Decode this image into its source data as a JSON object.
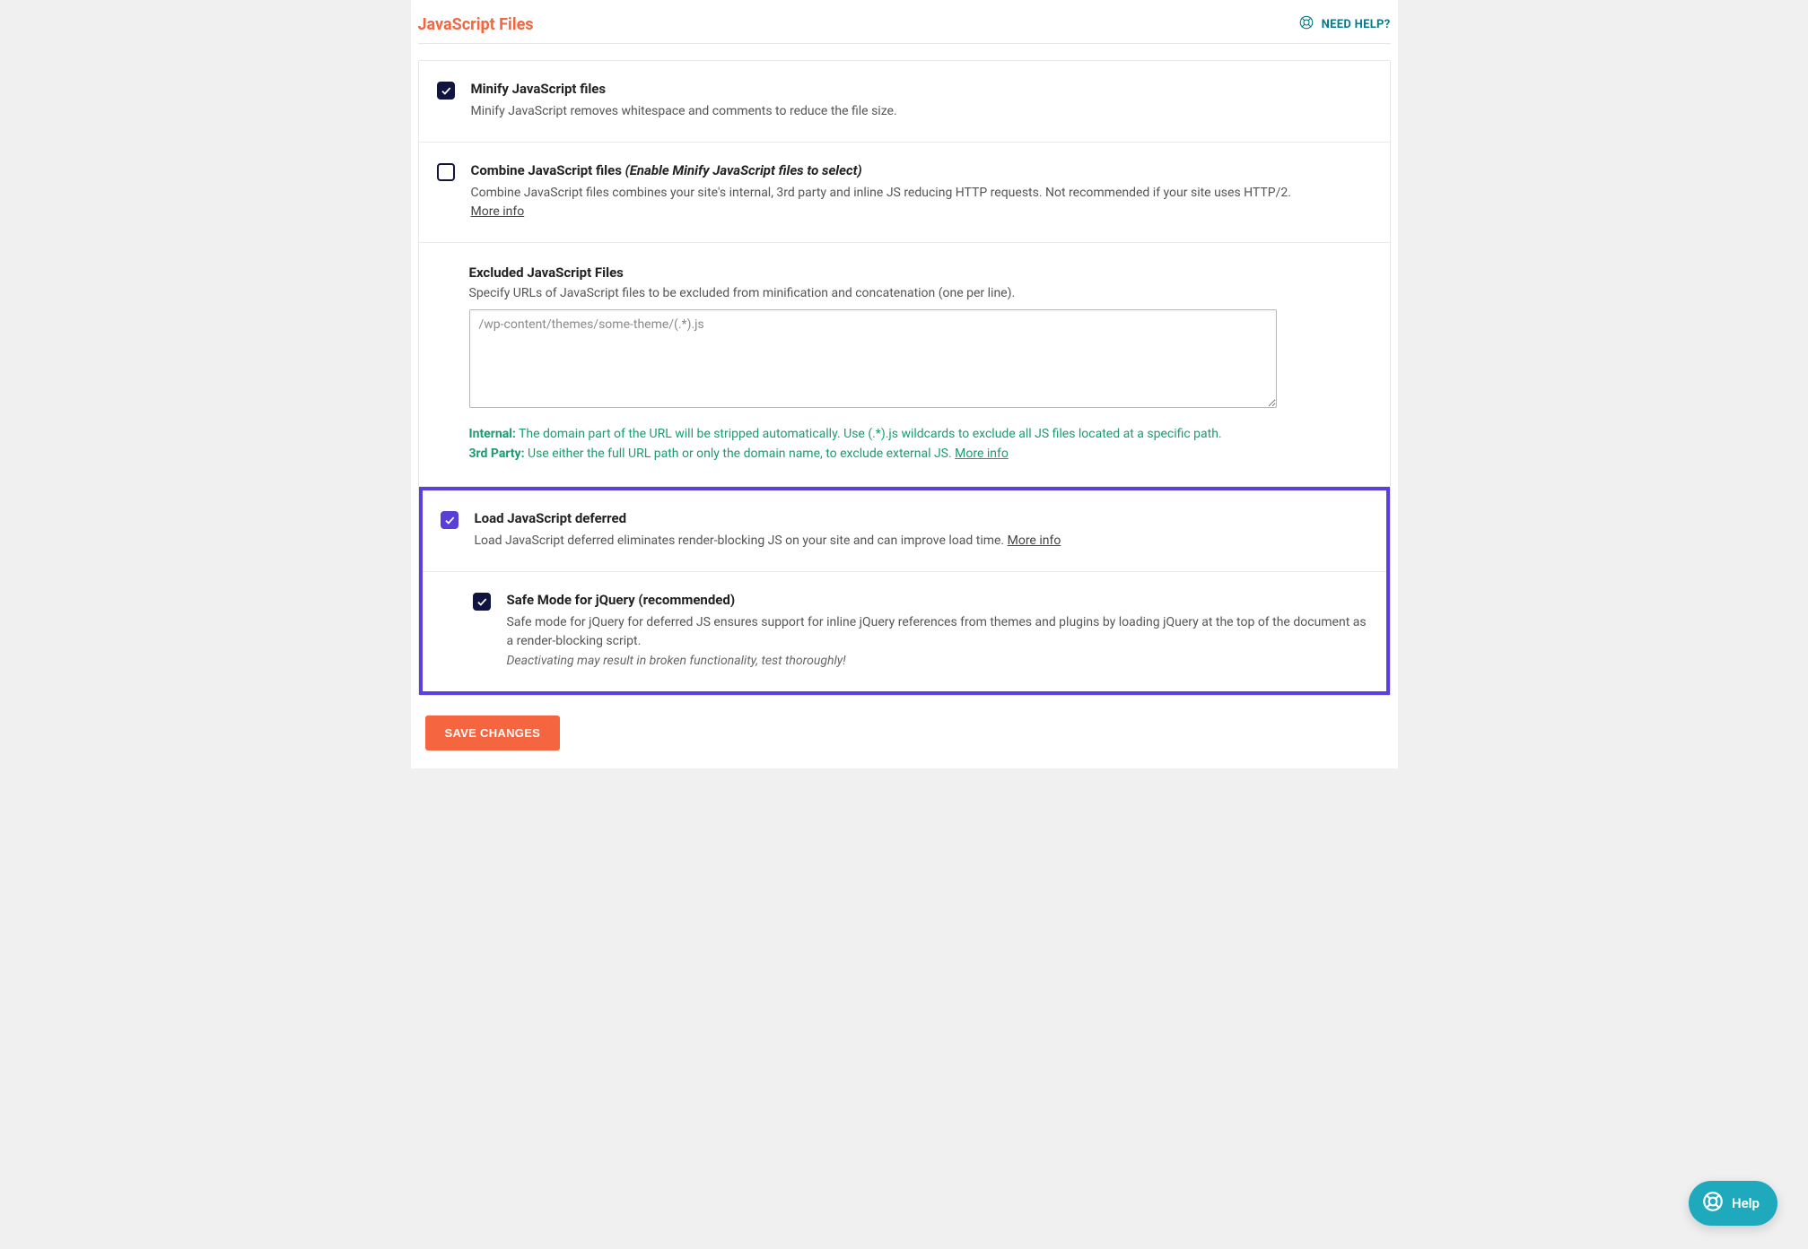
{
  "header": {
    "title": "JavaScript Files",
    "need_help": "NEED HELP?"
  },
  "settings": {
    "minify": {
      "title": "Minify JavaScript files",
      "desc": "Minify JavaScript removes whitespace and comments to reduce the file size."
    },
    "combine": {
      "title": "Combine JavaScript files",
      "hint": "(Enable Minify JavaScript files to select)",
      "desc": "Combine JavaScript files combines your site's internal, 3rd party and inline JS reducing HTTP requests. Not recommended if your site uses HTTP/2.",
      "more": "More info"
    },
    "excluded": {
      "title": "Excluded JavaScript Files",
      "desc": "Specify URLs of JavaScript files to be excluded from minification and concatenation (one per line).",
      "placeholder": "/wp-content/themes/some-theme/(.*).js",
      "note_internal_label": "Internal:",
      "note_internal": " The domain part of the URL will be stripped automatically. Use (.*).js wildcards to exclude all JS files located at a specific path.",
      "note_3rd_label": "3rd Party:",
      "note_3rd": " Use either the full URL path or only the domain name, to exclude external JS. ",
      "more": "More info"
    },
    "defer": {
      "title": "Load JavaScript deferred",
      "desc": "Load JavaScript deferred eliminates render-blocking JS on your site and can improve load time. ",
      "more": "More info"
    },
    "safe": {
      "title": "Safe Mode for jQuery (recommended)",
      "desc": "Safe mode for jQuery for deferred JS ensures support for inline jQuery references from themes and plugins by loading jQuery at the top of the document as a render-blocking script.",
      "warn": "Deactivating may result in broken functionality, test thoroughly!"
    }
  },
  "save_label": "SAVE CHANGES",
  "help_fab": "Help"
}
